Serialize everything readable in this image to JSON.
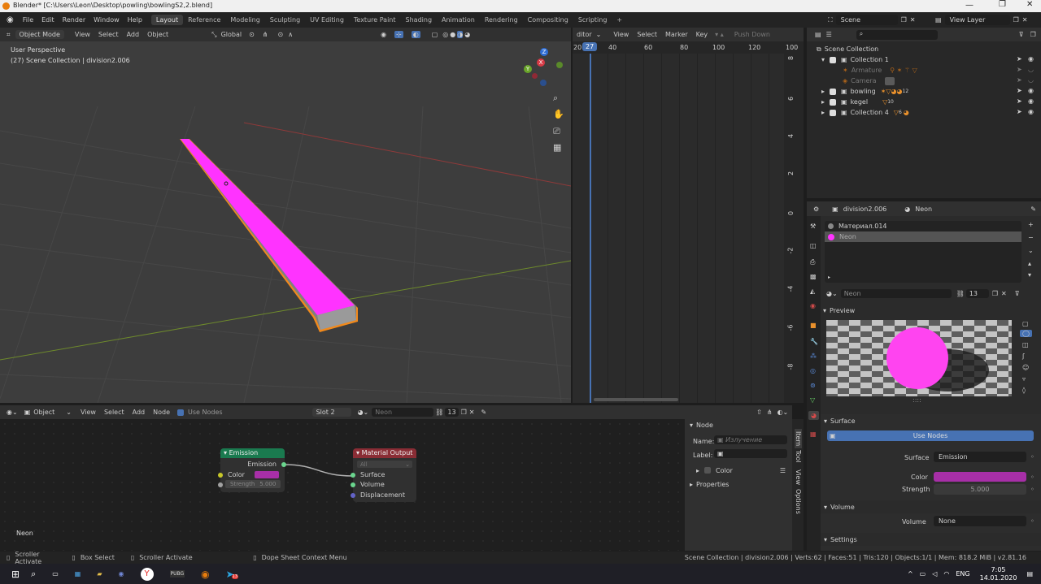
{
  "window": {
    "title": "Blender* [C:\\Users\\Leon\\Desktop\\powling\\bowlingS2,2.blend]"
  },
  "menu": {
    "items": [
      "File",
      "Edit",
      "Render",
      "Window",
      "Help"
    ]
  },
  "workspaces": [
    "Layout",
    "Reference",
    "Modeling",
    "Sculpting",
    "UV Editing",
    "Texture Paint",
    "Shading",
    "Animation",
    "Rendering",
    "Compositing",
    "Scripting"
  ],
  "active_workspace": "Layout",
  "scene": {
    "scene_label": "Scene",
    "view_layer_label": "View Layer"
  },
  "viewport": {
    "mode": "Object Mode",
    "menus": [
      "View",
      "Select",
      "Add",
      "Object"
    ],
    "orientation": "Global",
    "info_line1": "User Perspective",
    "info_line2": "(27) Scene Collection | division2.006",
    "gizmo": {
      "x": "X",
      "y": "Y",
      "z": "Z"
    },
    "neon_color": "#ff33ff",
    "outline_color": "#f28a1c"
  },
  "dopesheet": {
    "editor_label": "ditor",
    "menus": [
      "View",
      "Select",
      "Marker",
      "Key"
    ],
    "push_down": "Push Down",
    "frames": [
      "20",
      "27",
      "40",
      "60",
      "80",
      "100",
      "120"
    ],
    "current_frame": "27",
    "y_ticks": [
      "100",
      "8",
      "6",
      "4",
      "2",
      "0",
      "-2",
      "-4",
      "-6",
      "-8"
    ]
  },
  "outliner": {
    "search_placeholder": "",
    "root": "Scene Collection",
    "items": [
      {
        "label": "Collection 1",
        "level": 0
      },
      {
        "label": "Armature",
        "level": 1,
        "dim": true
      },
      {
        "label": "Camera",
        "level": 1,
        "dim": true
      },
      {
        "label": "bowling",
        "level": 0
      },
      {
        "label": "kegel",
        "level": 0
      },
      {
        "label": "Collection 4",
        "level": 0
      }
    ],
    "badges": {
      "bowling_a": "3",
      "bowling_b": "2",
      "bowling_c": "12",
      "kegel": "10",
      "coll4_a": "6",
      "coll4_b": "1"
    }
  },
  "properties": {
    "object_name": "division2.006",
    "material_name": "Neon",
    "slots": [
      "Материал.014",
      "Neon"
    ],
    "mat_field": "Neon",
    "users": "13",
    "preview_label": "Preview",
    "surface_label": "Surface",
    "use_nodes": "Use Nodes",
    "surface_field_label": "Surface",
    "surface_value": "Emission",
    "color_label": "Color",
    "color_value": "#a72fa7",
    "strength_label": "Strength",
    "strength_value": "5.000",
    "volume_section": "Volume",
    "volume_label": "Volume",
    "volume_value": "None",
    "settings_section": "Settings"
  },
  "node_editor": {
    "type": "Object",
    "menus": [
      "View",
      "Select",
      "Add",
      "Node"
    ],
    "use_nodes": "Use Nodes",
    "slot": "Slot 2",
    "material": "Neon",
    "users": "13",
    "emission_node": {
      "title": "Emission",
      "output": "Emission",
      "color_label": "Color",
      "strength_label": "Strength",
      "strength_value": "5.000"
    },
    "output_node": {
      "title": "Material Output",
      "target": "All",
      "inputs": [
        "Surface",
        "Volume",
        "Displacement"
      ]
    },
    "material_label": "Neon",
    "sidebar": {
      "section": "Node",
      "name_label": "Name:",
      "name_value": "Излучение",
      "label_label": "Label:",
      "color_label": "Color",
      "properties": "Properties",
      "tabs": [
        "Item",
        "Tool",
        "View",
        "Options"
      ]
    }
  },
  "statusbar": {
    "left1": "Scroller Activate",
    "left2": "Box Select",
    "left3": "Scroller Activate",
    "left4": "Dope Sheet Context Menu",
    "right": "Scene Collection | division2.006 | Verts:62 | Faces:51 | Tris:120 | Objects:1/1 | Mem: 818.2 MiB | v2.81.16"
  },
  "taskbar": {
    "lang": "ENG",
    "time": "7:05",
    "date": "14.01.2020",
    "badge": "13"
  }
}
